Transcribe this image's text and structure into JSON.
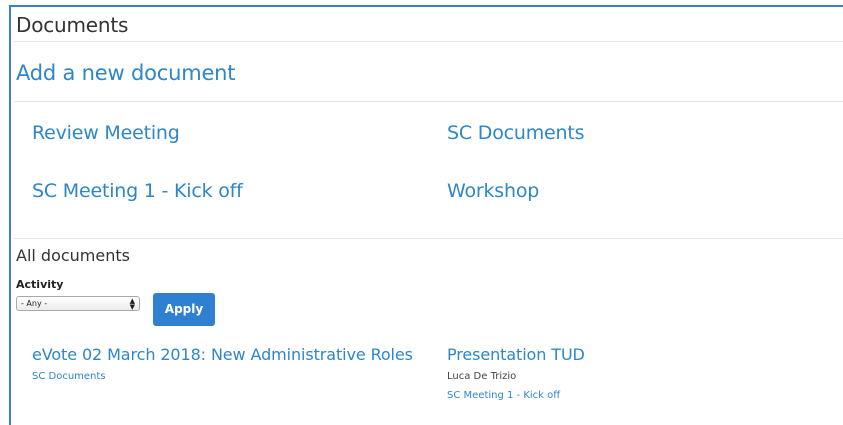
{
  "page": {
    "title": "Documents",
    "add_new": "Add a new document",
    "accent_color": "#2e86c9"
  },
  "folders": [
    {
      "label": "Review Meeting"
    },
    {
      "label": "SC Documents"
    },
    {
      "label": "SC Meeting 1 - Kick off"
    },
    {
      "label": "Workshop"
    }
  ],
  "filters": {
    "section_title": "All documents",
    "activity_label": "Activity",
    "activity_selected": "- Any -",
    "apply_label": "Apply"
  },
  "documents": [
    {
      "title": "eVote 02 March 2018: New Administrative Roles",
      "folder": "SC Documents"
    },
    {
      "title": "Presentation TUD",
      "author": "Luca De Trizio",
      "folder": "SC Meeting 1 - Kick off"
    }
  ]
}
